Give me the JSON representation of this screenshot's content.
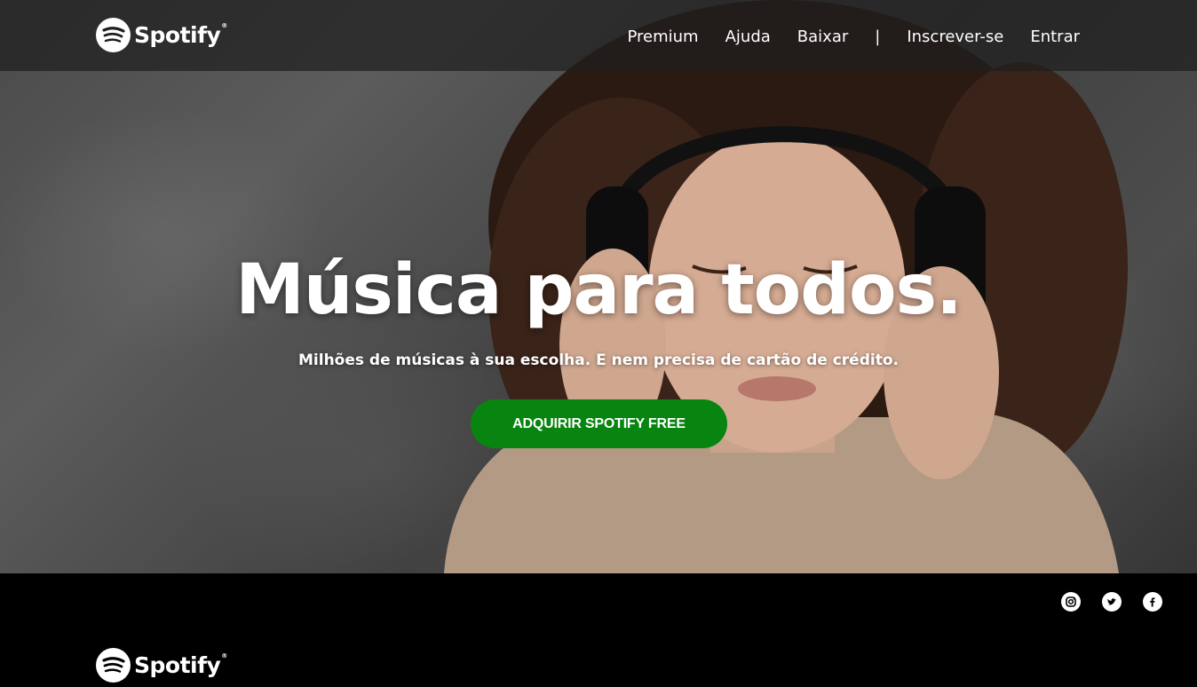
{
  "brand": {
    "name": "Spotify",
    "reg": "®"
  },
  "nav": {
    "items": [
      {
        "label": "Premium"
      },
      {
        "label": "Ajuda"
      },
      {
        "label": "Baixar"
      },
      {
        "label": "|"
      },
      {
        "label": "Inscrever-se"
      },
      {
        "label": "Entrar"
      }
    ]
  },
  "hero": {
    "headline": "Música para todos.",
    "subline": "Milhões de músicas à sua escolha. E nem precisa de cartão de crédito.",
    "cta": "ADQUIRIR SPOTIFY FREE"
  },
  "footer": {
    "social_icons": [
      "instagram-icon",
      "twitter-icon",
      "facebook-icon"
    ]
  },
  "colors": {
    "cta_green": "#078510",
    "footer_bg": "#000000",
    "topbar_bg": "#1e1e1e"
  }
}
